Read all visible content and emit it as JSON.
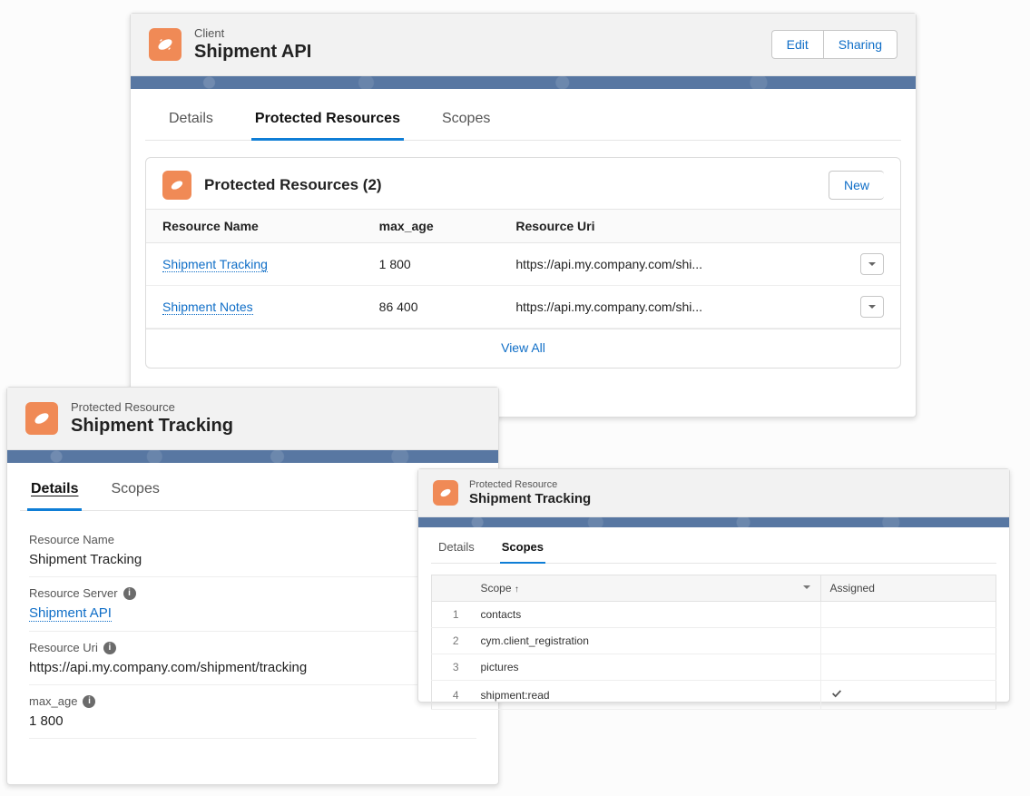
{
  "client_card": {
    "supertitle": "Client",
    "title": "Shipment API",
    "actions": {
      "edit": "Edit",
      "sharing": "Sharing"
    },
    "tabs": {
      "details": "Details",
      "protected": "Protected Resources",
      "scopes": "Scopes"
    },
    "list": {
      "heading": "Protected Resources (2)",
      "new_label": "New",
      "columns": {
        "name": "Resource Name",
        "max_age": "max_age",
        "uri": "Resource Uri"
      },
      "rows": [
        {
          "name": "Shipment Tracking",
          "max_age": "1 800",
          "uri": "https://api.my.company.com/shi..."
        },
        {
          "name": "Shipment Notes",
          "max_age": "86 400",
          "uri": "https://api.my.company.com/shi..."
        }
      ],
      "view_all": "View All"
    }
  },
  "details_card": {
    "supertitle": "Protected Resource",
    "title": "Shipment Tracking",
    "tabs": {
      "details": "Details",
      "scopes": "Scopes"
    },
    "fields": {
      "resource_name_label": "Resource Name",
      "resource_name_value": "Shipment Tracking",
      "resource_server_label": "Resource Server",
      "resource_server_value": "Shipment API",
      "resource_uri_label": "Resource Uri",
      "resource_uri_value": "https://api.my.company.com/shipment/tracking",
      "max_age_label": "max_age",
      "max_age_value": "1 800"
    }
  },
  "scopes_card": {
    "supertitle": "Protected Resource",
    "title": "Shipment Tracking",
    "tabs": {
      "details": "Details",
      "scopes": "Scopes"
    },
    "columns": {
      "scope": "Scope",
      "sort_marker": "↑",
      "assigned": "Assigned"
    },
    "rows": [
      {
        "idx": "1",
        "scope": "contacts",
        "assigned": false
      },
      {
        "idx": "2",
        "scope": "cym.client_registration",
        "assigned": false
      },
      {
        "idx": "3",
        "scope": "pictures",
        "assigned": false
      },
      {
        "idx": "4",
        "scope": "shipment:read",
        "assigned": true
      }
    ]
  }
}
